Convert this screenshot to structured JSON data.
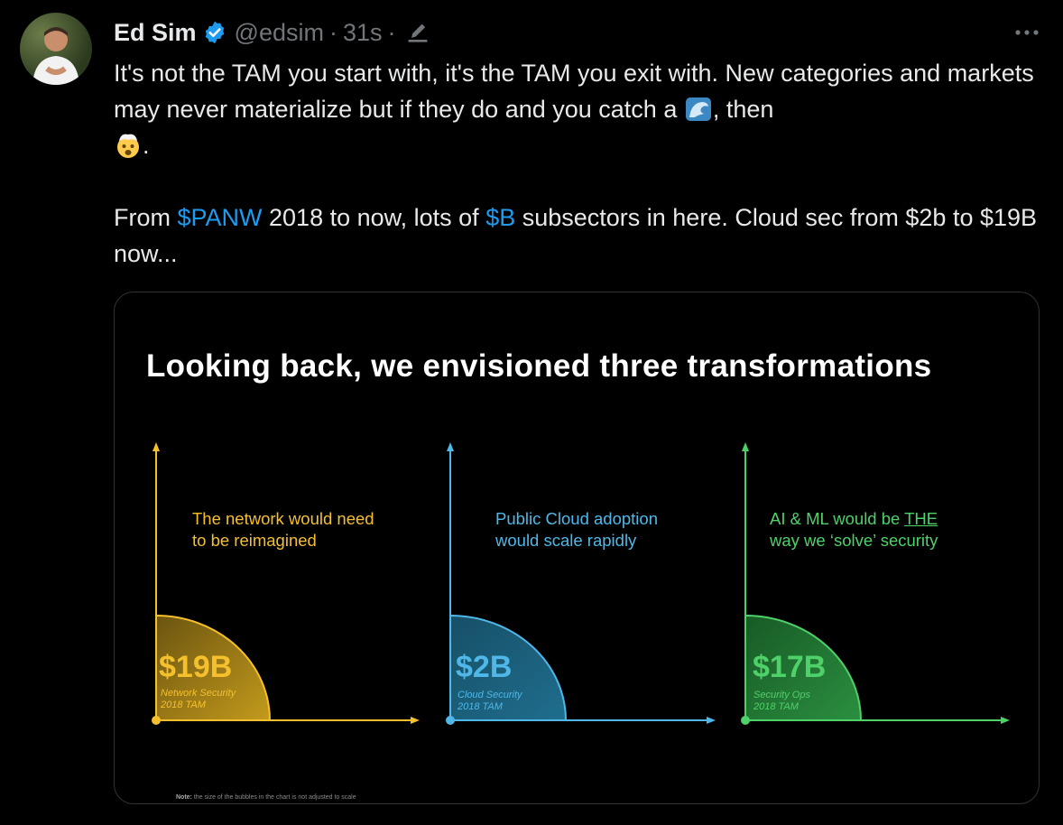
{
  "tweet": {
    "author_name": "Ed Sim",
    "handle": "@edsim",
    "time": "31s",
    "separator": "·",
    "line1": "It's not the TAM you start with, it's the TAM you exit with. New categories and markets may never materialize but if they do and you catch a",
    "line1_after_emoji": ", then",
    "line1_end": ".",
    "p2_a": "From ",
    "p2_link1": "$PANW",
    "p2_b": " 2018 to now, lots of ",
    "p2_link2": "$B",
    "p2_c": " subsectors in here. Cloud sec from $2b to $19B now...",
    "icons": [
      "verified-badge-icon",
      "edit-pencil-icon",
      "more-options-icon",
      "wave-emoji-icon",
      "exploding-head-emoji-icon"
    ]
  },
  "slide": {
    "title": "Looking back, we envisioned three transformations",
    "note_label": "Note:",
    "note_text": " the size of the bubbles in the chart is not adjusted to scale",
    "panels": [
      {
        "caption_l1": "The network would need",
        "caption_l2": "to be reimagined",
        "value": "$19B",
        "sub_l1": "Network Security",
        "sub_l2": "2018 TAM",
        "color": "#f5c02c"
      },
      {
        "caption_l1": "Public Cloud adoption",
        "caption_l2": "would scale rapidly",
        "value": "$2B",
        "sub_l1": "Cloud Security",
        "sub_l2": "2018 TAM",
        "color": "#4fb8e8"
      },
      {
        "caption_l1_a": "AI & ML would be ",
        "caption_l1_b": "THE",
        "caption_l2": "way we ‘solve’ security",
        "value": "$17B",
        "sub_l1": "Security Ops",
        "sub_l2": "2018 TAM",
        "color": "#4fd16a"
      }
    ]
  }
}
